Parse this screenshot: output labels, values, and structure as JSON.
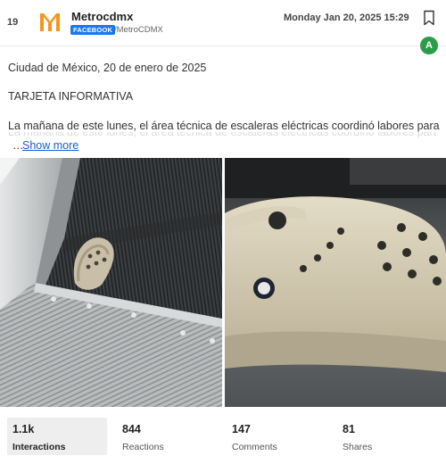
{
  "post": {
    "rank": "19",
    "page_name": "Metrocdmx",
    "platform": "FACEBOOK",
    "handle": "/MetroCDMX",
    "date": "Monday Jan 20, 2025 15:29",
    "avatar_letter": "A",
    "brand_color": "#f7941d",
    "lines": [
      "Ciudad de México, 20 de enero de 2025",
      "TARJETA INFORMATIVA",
      "La mañana de este lunes, el área técnica de escaleras eléctricas coordinó labores para"
    ],
    "ellipsis": "…",
    "show_more": "Show more"
  },
  "images": [
    {
      "name": "escalator-shoe-photo",
      "icon": "photo"
    },
    {
      "name": "clog-shoe-photo",
      "icon": "photo"
    }
  ],
  "stats": [
    {
      "value": "1.1k",
      "label": "Interactions",
      "active": true
    },
    {
      "value": "844",
      "label": "Reactions",
      "active": false
    },
    {
      "value": "147",
      "label": "Comments",
      "active": false
    },
    {
      "value": "81",
      "label": "Shares",
      "active": false
    }
  ]
}
